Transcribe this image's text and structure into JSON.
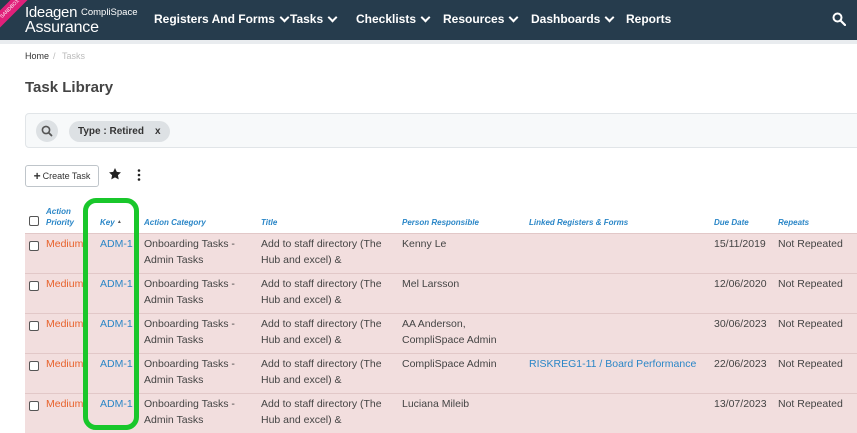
{
  "nav": {
    "badge": "SANDBOX",
    "logo_main": "Ideagen",
    "logo_sub": "CompliSpace",
    "logo_product": "Assurance",
    "items": [
      "Registers And Forms",
      "Tasks",
      "Checklists",
      "Resources",
      "Dashboards",
      "Reports"
    ],
    "search_icon": "search-icon"
  },
  "breadcrumb": {
    "home": "Home",
    "separator": "/",
    "current": "Tasks"
  },
  "page_title": "Task Library",
  "filter": {
    "search_icon": "search-icon",
    "chip_label": "Type : Retired",
    "chip_remove": "x"
  },
  "toolbar": {
    "create_label": "Create Task",
    "create_icon": "plus-icon",
    "star_icon": "star-icon",
    "more_icon": "kebab-menu-icon"
  },
  "table": {
    "headers": {
      "priority": [
        "Action",
        "Priority"
      ],
      "key": "Key",
      "sort_indicator": "▲",
      "category": "Action Category",
      "title": "Title",
      "person": "Person Responsible",
      "linked": "Linked Registers & Forms",
      "due": "Due Date",
      "repeats": "Repeats"
    },
    "rows": [
      {
        "priority": "Medium",
        "key": "ADM-1",
        "category": [
          "Onboarding Tasks -",
          "Admin Tasks"
        ],
        "title": [
          "Add to staff directory (The",
          "Hub and excel) &"
        ],
        "person": [
          "Kenny Le"
        ],
        "linked": "",
        "due": "15/11/2019",
        "repeats": "Not Repeated"
      },
      {
        "priority": "Medium",
        "key": "ADM-1",
        "category": [
          "Onboarding Tasks -",
          "Admin Tasks"
        ],
        "title": [
          "Add to staff directory (The",
          "Hub and excel) &"
        ],
        "person": [
          "Mel Larsson"
        ],
        "linked": "",
        "due": "12/06/2020",
        "repeats": "Not Repeated"
      },
      {
        "priority": "Medium",
        "key": "ADM-1",
        "category": [
          "Onboarding Tasks -",
          "Admin Tasks"
        ],
        "title": [
          "Add to staff directory (The",
          "Hub and excel) &"
        ],
        "person": [
          "AA Anderson,",
          "CompliSpace Admin"
        ],
        "linked": "",
        "due": "30/06/2023",
        "repeats": "Not Repeated"
      },
      {
        "priority": "Medium",
        "key": "ADM-1",
        "category": [
          "Onboarding Tasks -",
          "Admin Tasks"
        ],
        "title": [
          "Add to staff directory (The",
          "Hub and excel) &"
        ],
        "person": [
          "CompliSpace Admin"
        ],
        "linked": "RISKREG1-11 / Board Performance",
        "due": "22/06/2023",
        "repeats": "Not Repeated"
      },
      {
        "priority": "Medium",
        "key": "ADM-1",
        "category": [
          "Onboarding Tasks -",
          "Admin Tasks"
        ],
        "title": [
          "Add to staff directory (The",
          "Hub and excel) &"
        ],
        "person": [
          "Luciana Mileib"
        ],
        "linked": "",
        "due": "13/07/2023",
        "repeats": "Not Repeated"
      }
    ]
  },
  "colors": {
    "nav_bg": "#263c4d",
    "link": "#2a86c7",
    "priority": "#e8622c",
    "row_bg": "#f2dede",
    "highlight": "#19c72b"
  }
}
